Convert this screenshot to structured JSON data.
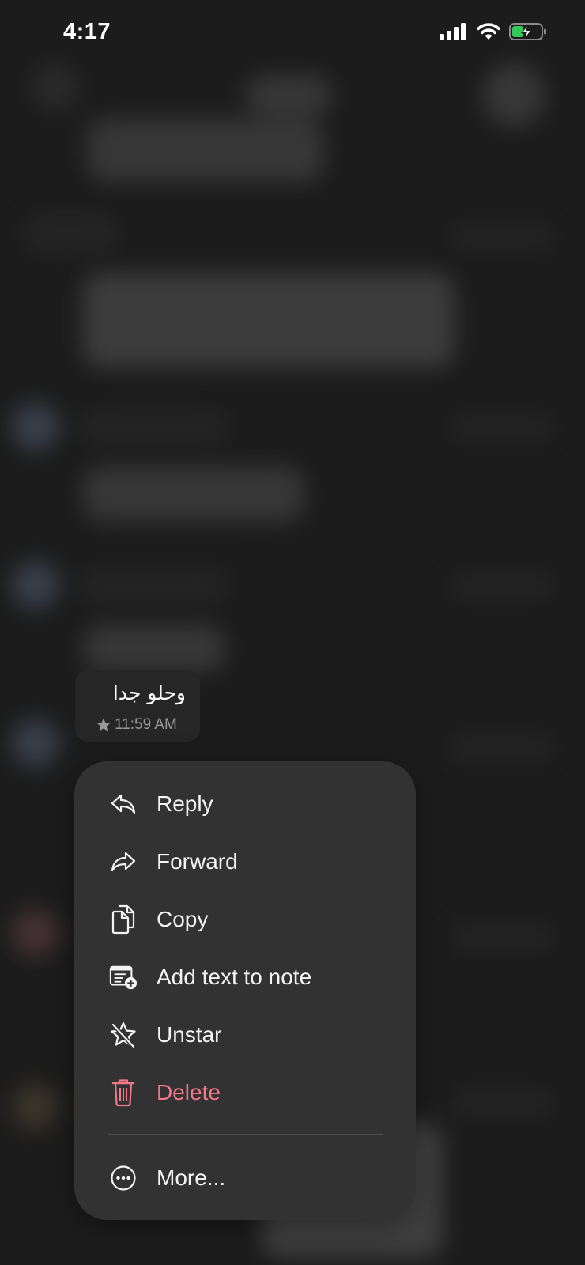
{
  "status_bar": {
    "time": "4:17"
  },
  "message": {
    "text": "وحلو جدا",
    "time": "11:59 AM",
    "starred": true
  },
  "context_menu": {
    "items": [
      {
        "label": "Reply",
        "icon": "reply-icon"
      },
      {
        "label": "Forward",
        "icon": "forward-icon"
      },
      {
        "label": "Copy",
        "icon": "copy-icon"
      },
      {
        "label": "Add text to note",
        "icon": "add-note-icon"
      },
      {
        "label": "Unstar",
        "icon": "unstar-icon"
      },
      {
        "label": "Delete",
        "icon": "trash-icon"
      },
      {
        "label": "More...",
        "icon": "more-icon"
      }
    ]
  },
  "colors": {
    "background": "#1c1c1c",
    "menu_background": "#323232",
    "danger": "#f2788a",
    "battery_green": "#34c759"
  }
}
